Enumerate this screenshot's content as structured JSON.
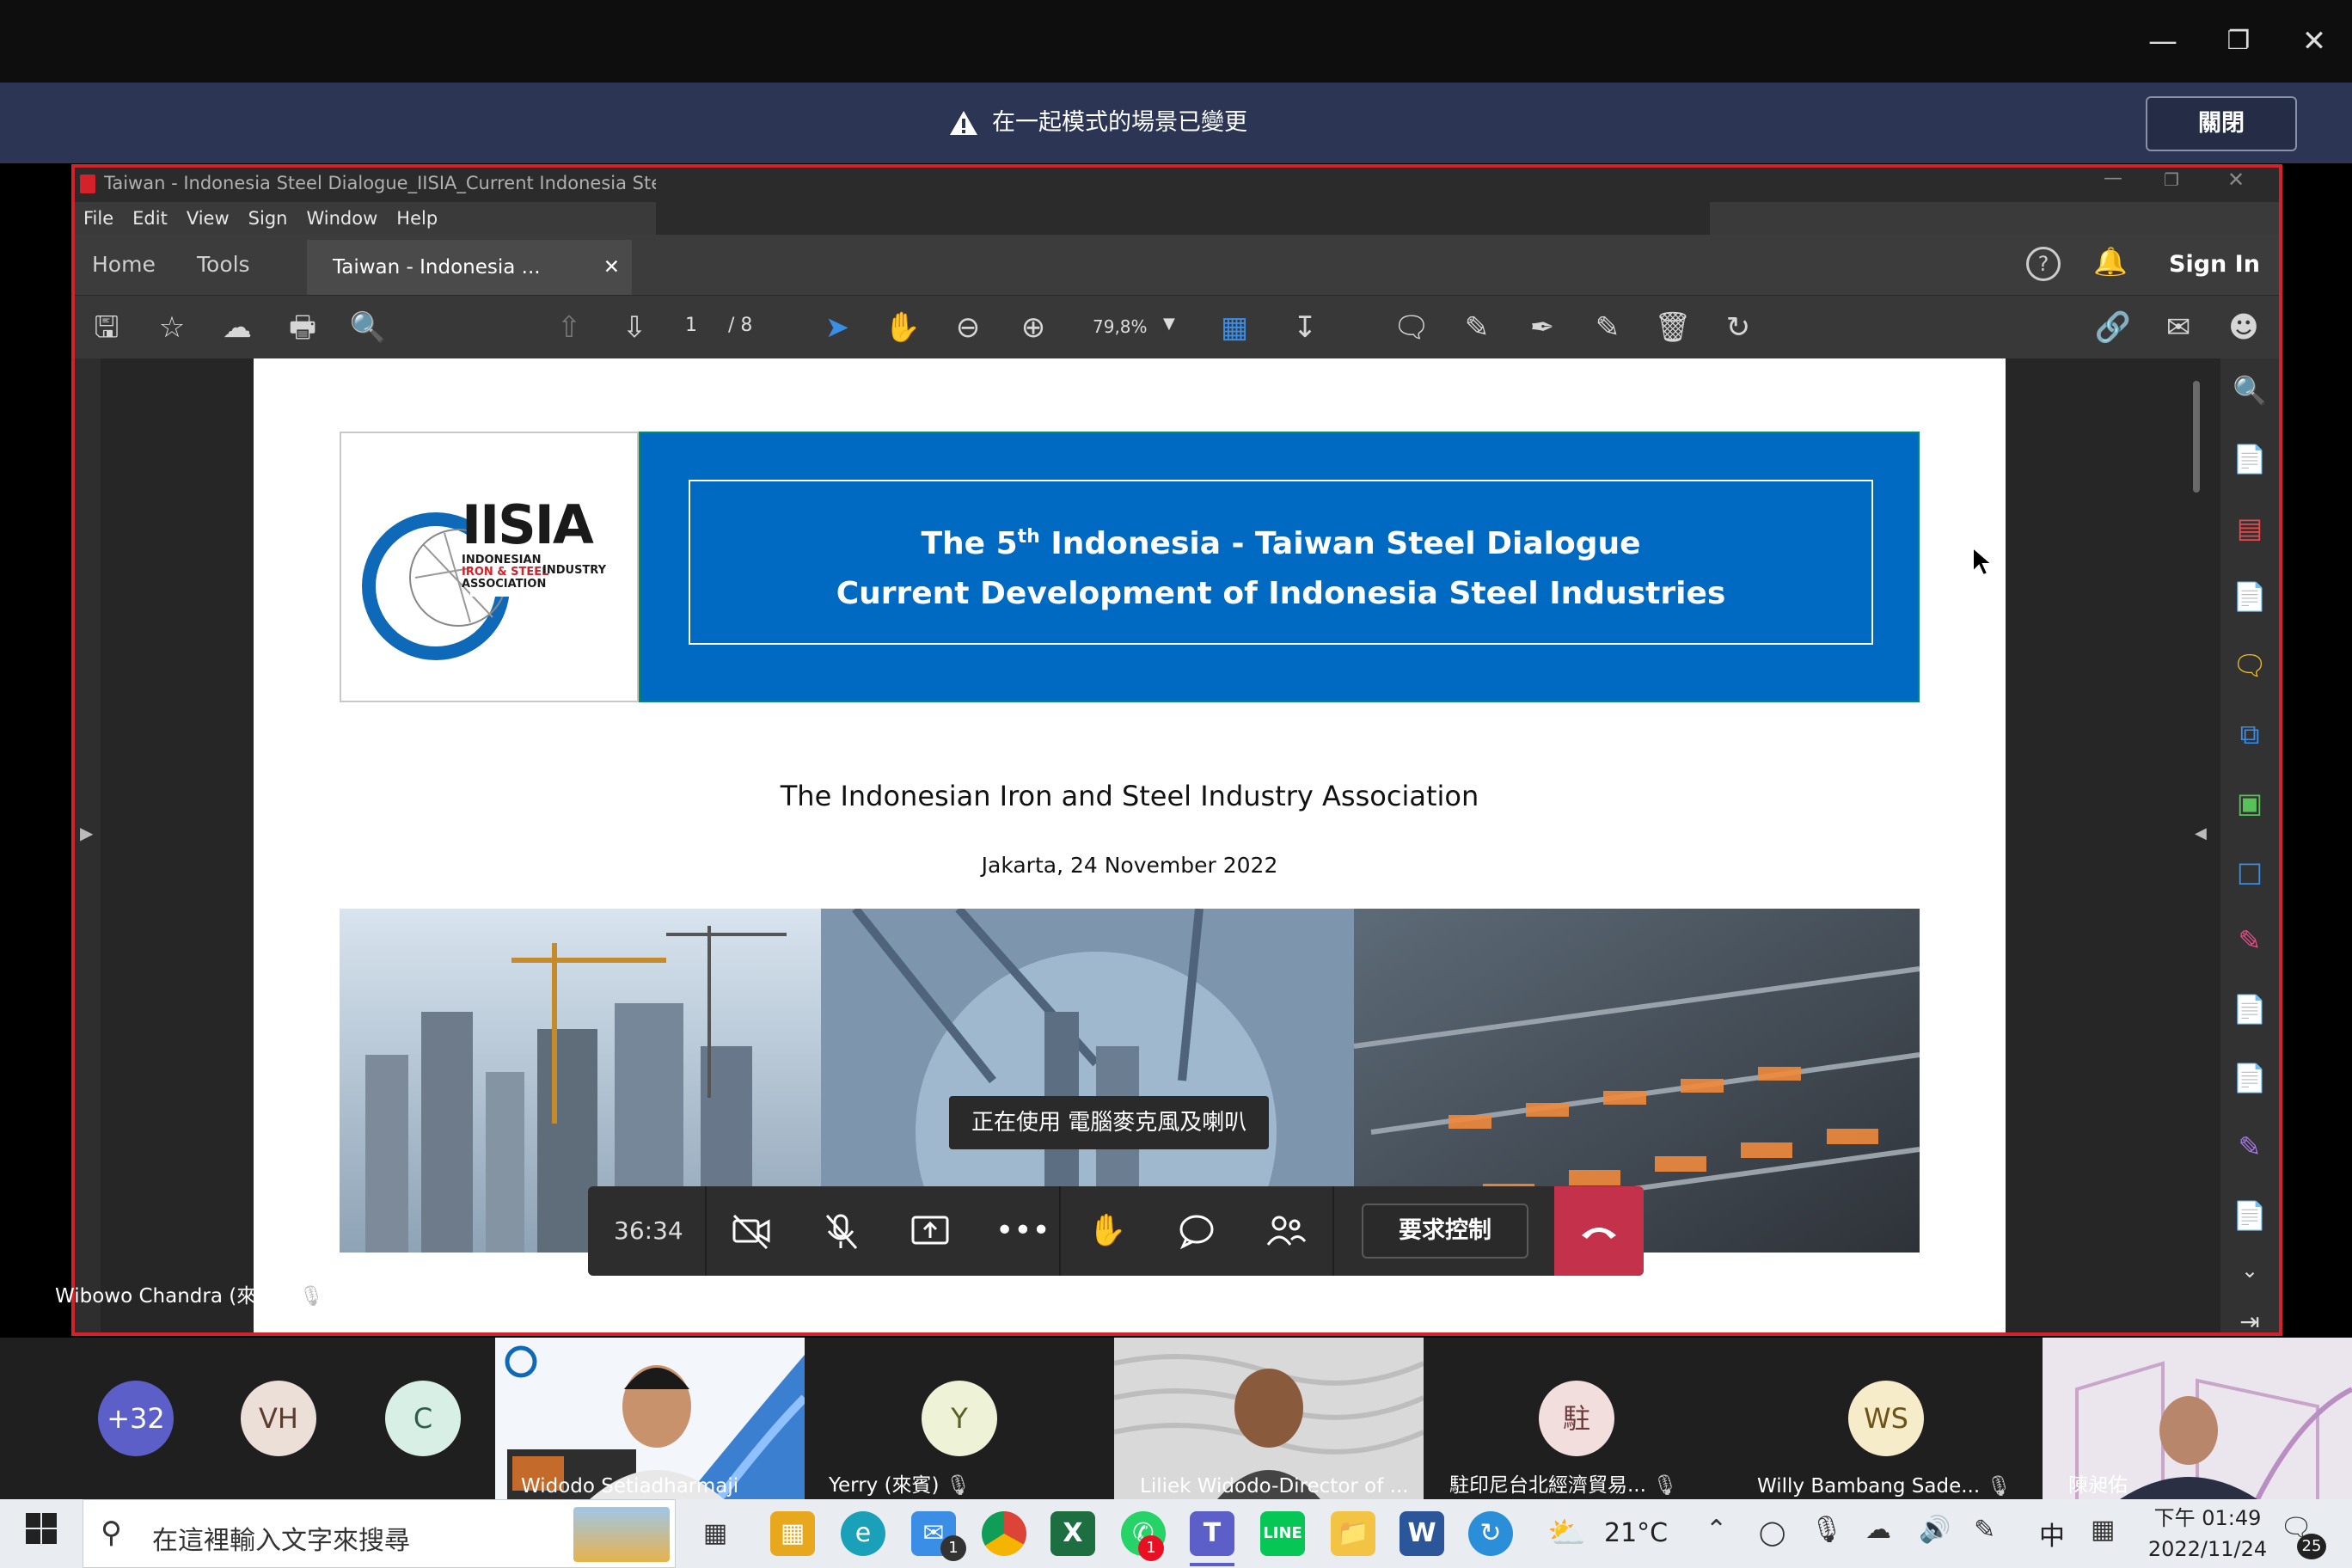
{
  "banner": {
    "message": "在一起模式的場景已變更",
    "close_label": "關閉"
  },
  "acrobat": {
    "window_title": "Taiwan - Indonesia Steel Dialogue_IISIA_Current Indonesia Steel Deve",
    "menu": [
      "File",
      "Edit",
      "View",
      "Sign",
      "Window",
      "Help"
    ],
    "tabs": {
      "home": "Home",
      "tools": "Tools",
      "doc": "Taiwan - Indonesia ...",
      "sign_in": "Sign In"
    },
    "page_current": "1",
    "page_total": "/ 8",
    "zoom": "79,8%"
  },
  "slide": {
    "logo_text": "IISIA",
    "logo_sub_1": "INDONESIAN",
    "logo_sub_2": "IRON & STEEL",
    "logo_sub_3": "INDUSTRY",
    "logo_sub_4": "ASSOCIATION",
    "title_pre": "The 5",
    "title_sup": "th",
    "title_post": " Indonesia - Taiwan Steel Dialogue",
    "subtitle": "Current Development of Indonesia Steel Industries",
    "association": "The Indonesian Iron and Steel Industry Association",
    "date": "Jakarta, 24 November 2022"
  },
  "meeting": {
    "caption": "正在使用 電腦麥克風及喇叭",
    "timer": "36:34",
    "request_control": "要求控制",
    "presenter": "Wibowo Chandra (來賓)"
  },
  "participants": {
    "overflow": "+32",
    "avatars": [
      {
        "initials": "VH",
        "bg": "#ecdfd8",
        "fg": "#5a3d2e"
      },
      {
        "initials": "C",
        "bg": "#d7efe4",
        "fg": "#2f5d4a"
      },
      {
        "initials": "Y",
        "bg": "#eef2d6",
        "fg": "#5b6126"
      },
      {
        "initials": "駐",
        "bg": "#f3dede",
        "fg": "#6b3a3a"
      },
      {
        "initials": "WS",
        "bg": "#f7ecc9",
        "fg": "#6c5418"
      }
    ],
    "names": {
      "widodo": "Widodo Setiadharmaji",
      "yerry": "Yerry (來賓)",
      "liliek": "Liliek Widodo-Director of ...",
      "office": "駐印尼台北經濟貿易...",
      "willy": "Willy Bambang Sade...",
      "chen": "陳昶佑"
    }
  },
  "taskbar": {
    "search_placeholder": "在這裡輸入文字來搜尋",
    "weather": "21°C",
    "ime": "中",
    "time": "下午 01:49",
    "date": "2022/11/24",
    "notifications": "25",
    "mail_badge": "1",
    "whatsapp_badge": "1"
  },
  "colors": {
    "accent_red": "#d4212a",
    "slide_blue": "#0069c2",
    "hangup": "#c4314b",
    "banner": "#2c3553"
  }
}
